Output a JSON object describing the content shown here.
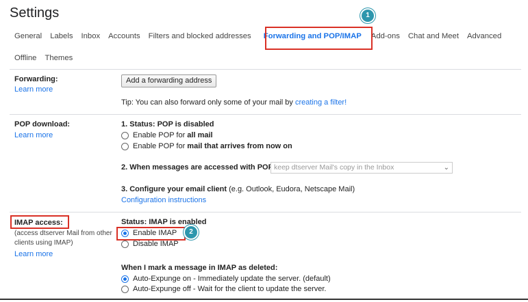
{
  "header": {
    "title": "Settings"
  },
  "tabs_row1": [
    {
      "label": "General",
      "active": false
    },
    {
      "label": "Labels",
      "active": false
    },
    {
      "label": "Inbox",
      "active": false
    },
    {
      "label": "Accounts",
      "active": false
    },
    {
      "label": "Filters and blocked addresses",
      "active": false
    },
    {
      "label": "Forwarding and POP/IMAP",
      "active": true
    },
    {
      "label": "Add-ons",
      "active": false
    },
    {
      "label": "Chat and Meet",
      "active": false
    },
    {
      "label": "Advanced",
      "active": false
    }
  ],
  "tabs_row2": [
    {
      "label": "Offline",
      "active": false
    },
    {
      "label": "Themes",
      "active": false
    }
  ],
  "badges": {
    "one": "1",
    "two": "2"
  },
  "forwarding": {
    "label": "Forwarding:",
    "learn_more": "Learn more",
    "add_button": "Add a forwarding address",
    "tip_prefix": "Tip: You can also forward only some of your mail by ",
    "tip_link": "creating a filter!"
  },
  "pop": {
    "label": "POP download:",
    "learn_more": "Learn more",
    "status_prefix": "1. Status: ",
    "status_value": "POP is disabled",
    "option_all_prefix": "Enable POP for ",
    "option_all_bold": "all mail",
    "option_now_prefix": "Enable POP for ",
    "option_now_bold": "mail that arrives from now on",
    "accessed_label": "2. When messages are accessed with POP",
    "accessed_select": "keep dtserver Mail's copy in the Inbox",
    "configure_label": "3. Configure your email client",
    "configure_hint": " (e.g. Outlook, Eudora, Netscape Mail)",
    "configure_link": "Configuration instructions"
  },
  "imap": {
    "label": "IMAP access:",
    "desc_line1": "(access dtserver Mail from other",
    "desc_line2": "clients using IMAP)",
    "learn_more": "Learn more",
    "status": "Status: IMAP is enabled",
    "enable": "Enable IMAP",
    "disable": "Disable IMAP",
    "deleted_heading": "When I mark a message in IMAP as deleted:",
    "expunge_on": "Auto-Expunge on - Immediately update the server. (default)",
    "expunge_off": "Auto-Expunge off - Wait for the client to update the server."
  },
  "colors": {
    "accent": "#1a73e8",
    "highlight": "#d93025",
    "badge": "#2d96ad"
  }
}
